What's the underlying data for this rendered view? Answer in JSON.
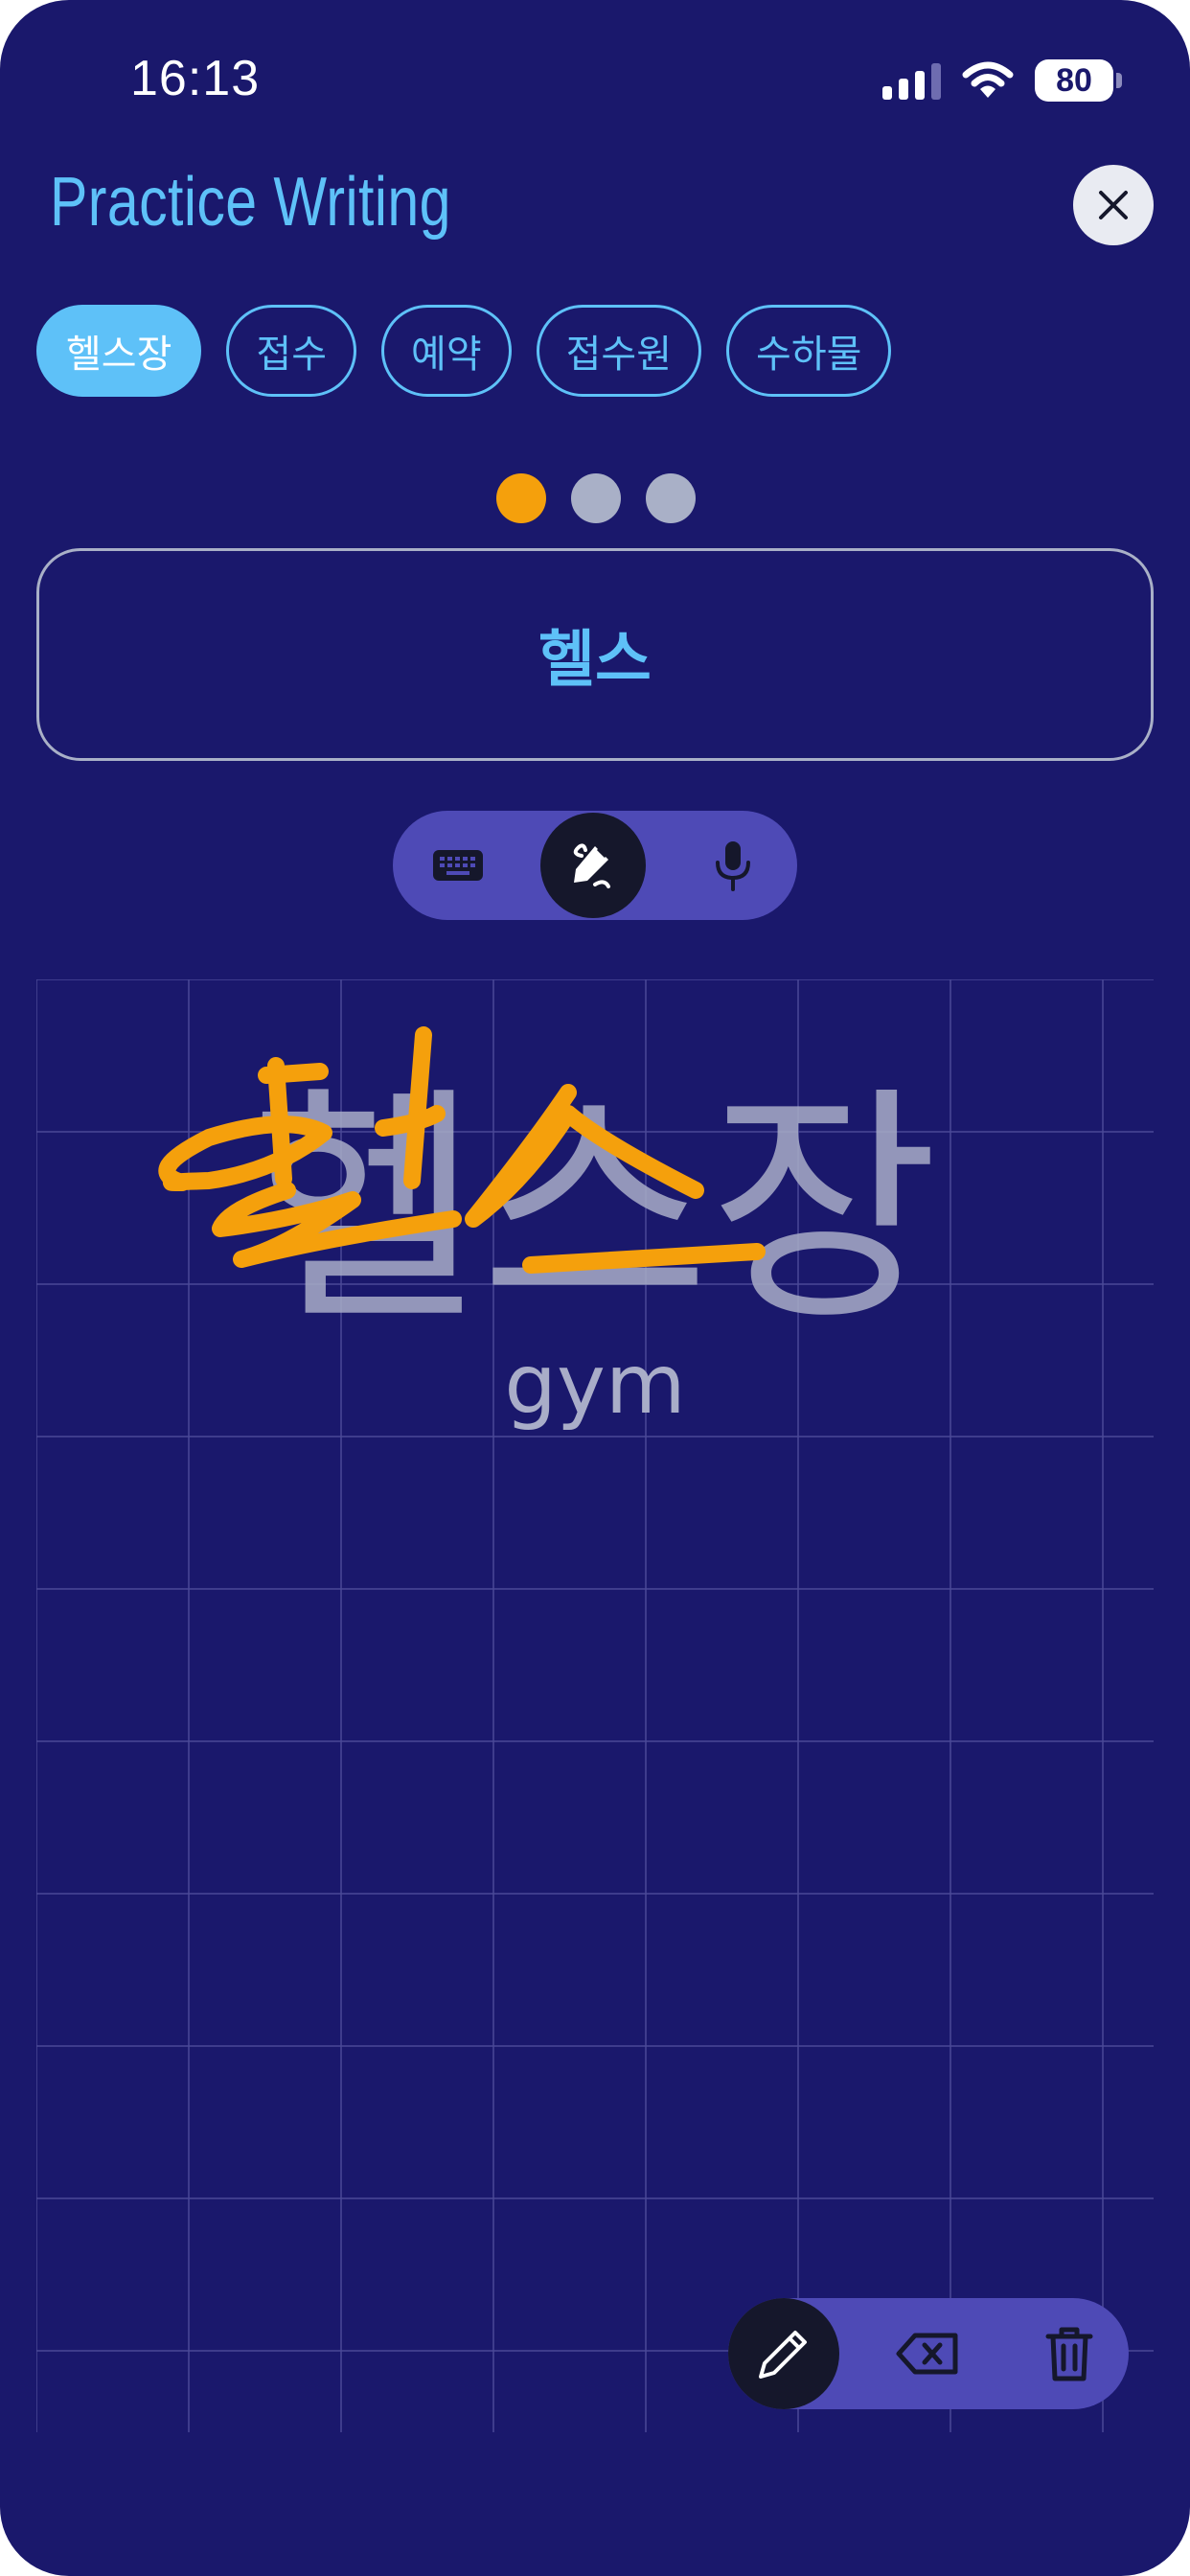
{
  "status_bar": {
    "time": "16:13",
    "battery_percent": "80"
  },
  "header": {
    "title": "Practice Writing",
    "close_icon": "close-icon"
  },
  "word_chips": [
    {
      "label": "헬스장",
      "active": true
    },
    {
      "label": "접수",
      "active": false
    },
    {
      "label": "예약",
      "active": false
    },
    {
      "label": "접수원",
      "active": false
    },
    {
      "label": "수하물",
      "active": false
    }
  ],
  "progress": {
    "current": 1,
    "total": 3
  },
  "answer": {
    "text": "헬스"
  },
  "input_modes": [
    {
      "icon": "keyboard-icon",
      "active": false
    },
    {
      "icon": "handwriting-icon",
      "active": true
    },
    {
      "icon": "microphone-icon",
      "active": false
    }
  ],
  "practice": {
    "target_word": "헬스장",
    "translation": "gym"
  },
  "tools": [
    {
      "icon": "pencil-icon",
      "active": true
    },
    {
      "icon": "backspace-icon",
      "active": false
    },
    {
      "icon": "trash-icon",
      "active": false
    }
  ],
  "colors": {
    "background": "#1a186c",
    "accent": "#5ec1f8",
    "stroke": "#f5a00c",
    "pill": "#4e4ab6",
    "dark_button": "#15172b"
  }
}
